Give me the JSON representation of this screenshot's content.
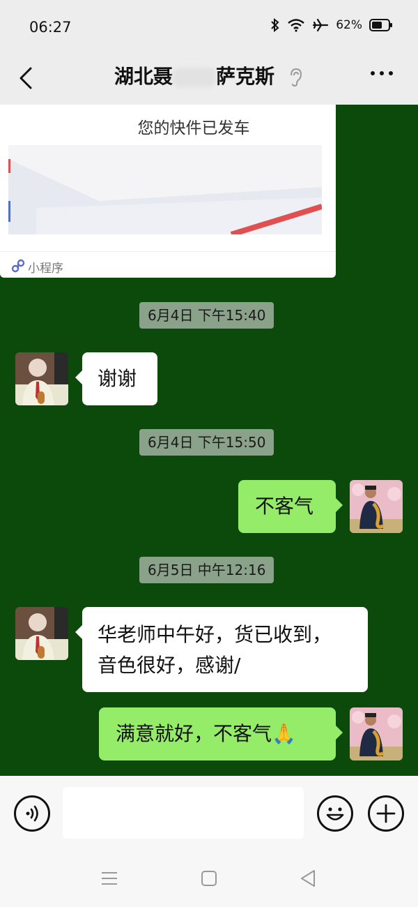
{
  "status_bar": {
    "time": "06:27",
    "battery": "62%",
    "battery_level": 0.62,
    "icons": [
      "bluetooth-icon",
      "wifi-icon",
      "airplane-icon",
      "battery-icon"
    ]
  },
  "header": {
    "title_start": "湖北聂",
    "title_end": "萨克斯",
    "icons": [
      "back-icon",
      "earpiece-icon",
      "more-icon"
    ]
  },
  "card": {
    "message": "您的快件已发车",
    "label": "小程序"
  },
  "messages": [
    {
      "kind": "time",
      "text": "6月4日 下午15:40"
    },
    {
      "kind": "incoming",
      "lines": [
        "谢谢"
      ]
    },
    {
      "kind": "time",
      "text": "6月4日 下午15:50"
    },
    {
      "kind": "outgoing",
      "lines": [
        "不客气"
      ]
    },
    {
      "kind": "time",
      "text": "6月5日 中午12:16"
    },
    {
      "kind": "incoming",
      "lines": [
        "华老师中午好，货已收到，",
        "音色很好，感谢/"
      ]
    },
    {
      "kind": "outgoing",
      "lines": [
        "满意就好，不客气🙏"
      ]
    }
  ],
  "input_bar": {
    "icons": [
      "voice-icon",
      "emoji-icon",
      "plus-icon"
    ]
  },
  "nav_bar": {
    "icons": [
      "menu-icon",
      "home-icon",
      "back-triangle-icon"
    ]
  },
  "colors": {
    "chat_background": "#0c4a0c",
    "incoming_bubble": "#ffffff",
    "outgoing_bubble": "#95ec69",
    "timestamp_background": "#8aa18a"
  }
}
